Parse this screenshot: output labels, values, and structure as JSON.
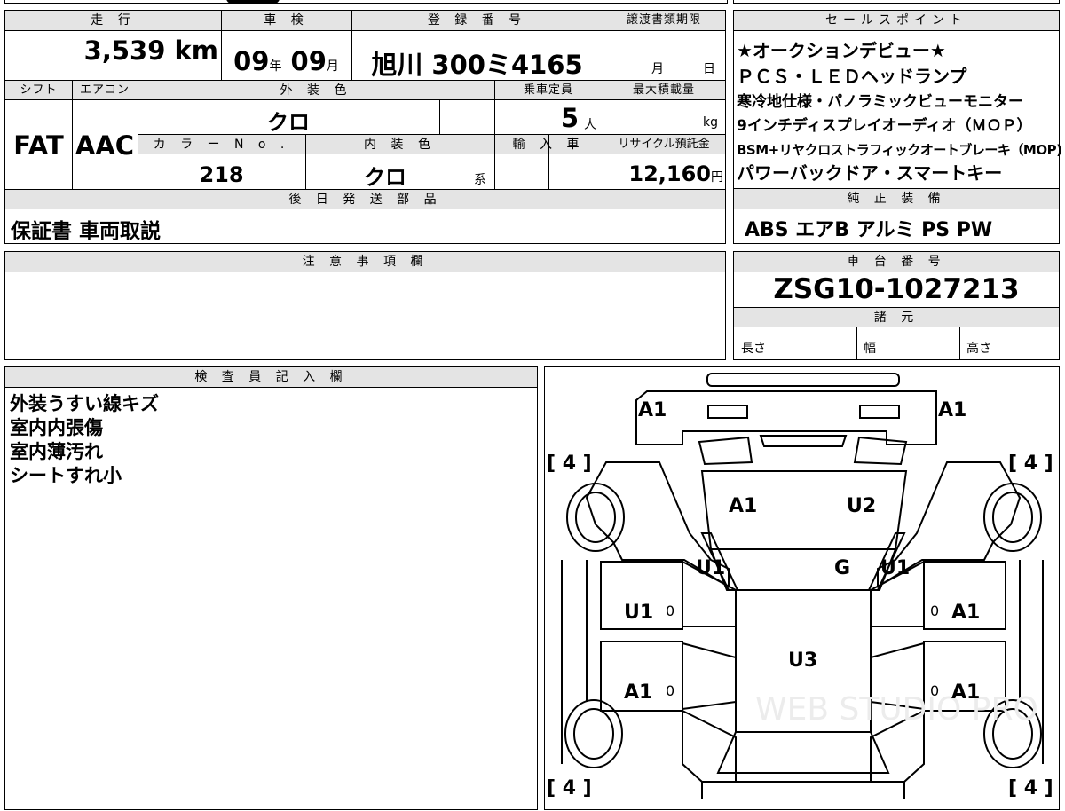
{
  "info": {
    "mileage_label": "走 行",
    "mileage_value": "3,539",
    "mileage_unit": "km",
    "shaken_label": "車 検",
    "shaken_year": "09",
    "shaken_year_unit": "年",
    "shaken_month": "09",
    "shaken_month_unit": "月",
    "reg_label": "登 録 番 号",
    "reg_value": "旭川 300ミ4165",
    "transfer_label": "譲渡書類期限",
    "transfer_month_unit": "月",
    "transfer_day_unit": "日",
    "shift_label": "シフト",
    "shift_value": "FAT",
    "ac_label": "エアコン",
    "ac_value": "AAC",
    "exterior_label": "外 装 色",
    "exterior_value": "クロ",
    "capacity_label": "乗車定員",
    "capacity_value": "5",
    "capacity_unit": "人",
    "load_label": "最大積載量",
    "load_unit": "kg",
    "color_no_label": "カ ラ ー N o .",
    "color_no_value": "218",
    "interior_label": "内 装 色",
    "interior_value": "クロ",
    "interior_suffix": "系",
    "import_label": "輸 入 車",
    "recycle_label": "リサイクル預託金",
    "recycle_value": "12,160",
    "recycle_unit": "円",
    "later_parts_label": "後 日 発 送 部 品",
    "later_parts_value": "保証書 車両取説"
  },
  "sales_points": {
    "label": "セールスポイント",
    "lines": [
      "★オークションデビュー★",
      "ＰＣＳ・ＬＥＤヘッドランプ",
      "寒冷地仕様・パノラミックビューモニター",
      "9インチディスプレイオーディオ（ＭＯＰ）",
      "BSM+リヤクロストラフィックオートブレーキ（MOP)",
      "パワーバックドア・スマートキー"
    ]
  },
  "equipment": {
    "label": "純 正 装 備",
    "value": "ABS エアB アルミ PS PW"
  },
  "notes": {
    "label": "注 意 事 項 欄"
  },
  "chassis": {
    "label": "車 台 番 号",
    "value": "ZSG10-1027213",
    "specs_label": "諸 元",
    "length_label": "長さ",
    "width_label": "幅",
    "height_label": "高さ"
  },
  "inspector": {
    "label": "検 査 員 記 入 欄",
    "lines": [
      "外装うすい線キズ",
      "室内内張傷",
      "室内薄汚れ",
      "シートすれ小"
    ]
  },
  "diagram": {
    "marks": {
      "front_left": "A1",
      "front_right": "A1",
      "hood_left": "A1",
      "hood_right": "U2",
      "pillar_left": "U1",
      "windshield": "G",
      "pillar_right": "U1",
      "front_door_left": "U1",
      "front_door_right": "A1",
      "roof": "U3",
      "rear_door_left": "A1",
      "rear_door_right": "A1"
    },
    "tires": [
      "[ 4 ]",
      "[ 4 ]",
      "[ 4 ]",
      "[ 4 ]"
    ],
    "zero": "0",
    "watermark": "WEB STUDIO PRO"
  }
}
